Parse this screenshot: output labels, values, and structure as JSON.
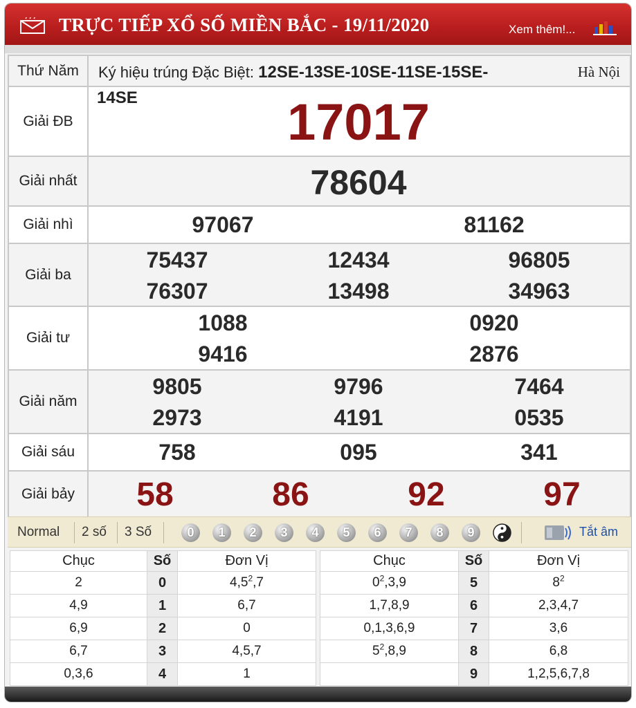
{
  "header": {
    "title": "TRỰC TIẾP XỔ SỐ MIỀN BẮC - 19/11/2020",
    "more_link": "Xem thêm!..."
  },
  "info": {
    "weekday": "Thứ Năm",
    "kyhieu_label": "Ký hiệu trúng Đặc Biệt:",
    "kyhieu_value_line1": "12SE-13SE-10SE-11SE-15SE-",
    "kyhieu_value_line2": "14SE",
    "place": "Hà Nội"
  },
  "prizes": {
    "db": {
      "label": "Giải ĐB",
      "numbers": [
        "17017"
      ]
    },
    "nhat": {
      "label": "Giải nhất",
      "numbers": [
        "78604"
      ]
    },
    "nhi": {
      "label": "Giải nhì",
      "numbers": [
        "97067",
        "81162"
      ]
    },
    "ba": {
      "label": "Giải ba",
      "numbers": [
        "75437",
        "12434",
        "96805",
        "76307",
        "13498",
        "34963"
      ]
    },
    "tu": {
      "label": "Giải tư",
      "numbers": [
        "1088",
        "0920",
        "9416",
        "2876"
      ]
    },
    "nam": {
      "label": "Giải năm",
      "numbers": [
        "9805",
        "9796",
        "7464",
        "2973",
        "4191",
        "0535"
      ]
    },
    "sau": {
      "label": "Giải sáu",
      "numbers": [
        "758",
        "095",
        "341"
      ]
    },
    "bay": {
      "label": "Giải bảy",
      "numbers": [
        "58",
        "86",
        "92",
        "97"
      ]
    }
  },
  "toolbar": {
    "normal": "Normal",
    "two": "2 số",
    "three": "3 Số",
    "digits": [
      "0",
      "1",
      "2",
      "3",
      "4",
      "5",
      "6",
      "7",
      "8",
      "9"
    ],
    "mute": "Tắt âm"
  },
  "loto": {
    "headers": {
      "chuc": "Chục",
      "so": "Số",
      "donvi": "Đơn Vị"
    },
    "left": [
      {
        "chuc": "2",
        "so": "0",
        "donvi_html": "4,5<sup>2</sup>,7"
      },
      {
        "chuc": "4,9",
        "so": "1",
        "donvi_html": "6,7"
      },
      {
        "chuc": "6,9",
        "so": "2",
        "donvi_html": "0"
      },
      {
        "chuc": "6,7",
        "so": "3",
        "donvi_html": "4,5,7"
      },
      {
        "chuc": "0,3,6",
        "so": "4",
        "donvi_html": "1"
      }
    ],
    "right": [
      {
        "chuc_html": "0<sup>2</sup>,3,9",
        "so": "5",
        "donvi_html": "8<sup>2</sup>"
      },
      {
        "chuc_html": "1,7,8,9",
        "so": "6",
        "donvi_html": "2,3,4,7"
      },
      {
        "chuc_html": "0,1,3,6,9",
        "so": "7",
        "donvi_html": "3,6"
      },
      {
        "chuc_html": "5<sup>2</sup>,8,9",
        "so": "8",
        "donvi_html": "6,8"
      },
      {
        "chuc_html": "",
        "so": "9",
        "donvi_html": "1,2,5,6,7,8"
      }
    ]
  }
}
